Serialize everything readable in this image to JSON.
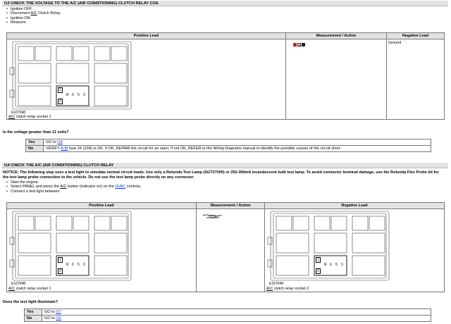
{
  "section1": {
    "heading": "I13   CHECK THE VOLTAGE TO THE A/C (AIR CONDITIONING) CLUTCH RELAY COIL",
    "steps": [
      {
        "pre": "Ignition OFF.",
        "u": "",
        "post": ""
      },
      {
        "pre": "Disconnect ",
        "u": "A/C",
        "post": " Clutch Relay."
      },
      {
        "pre": "Ignition ON.",
        "u": "",
        "post": ""
      },
      {
        "pre": "Measure:",
        "u": "",
        "post": ""
      }
    ],
    "table": {
      "headers": [
        "Positive Lead",
        "Measurement / Action",
        "Negative Lead"
      ],
      "figure_code": "E167048",
      "pins": {
        "p1": "1",
        "p2": "2",
        "r": "R",
        "p6": "6",
        "p5": "5",
        "p3": "3"
      },
      "caption_u": "A/C",
      "caption_rest": " clutch relay socket 1",
      "meter_icons": [
        "meter-red-icon",
        "meter-volt-icon",
        "meter-dc-icon"
      ],
      "negative": "Ground"
    },
    "question": "Is the voltage greater than 11 volts?",
    "answers": [
      {
        "key": "Yes",
        "pre": "GO to ",
        "link": "I14",
        "rest": ""
      },
      {
        "key": "No",
        "pre": "VERIFY ",
        "link": "BJB",
        "rest": " fuse 24 (10A) is OK. If OK, REPAIR the circuit for an open. If not OK, REFER to the Wiring Diagrams manual to identify the possible causes of the circuit short."
      }
    ]
  },
  "section2": {
    "heading": "I14   CHECK THE A/C (AIR CONDITIONING) CLUTCH RELAY",
    "notice": "NOTICE: The following step uses a test light to simulate normal circuit loads. Use only a Rotunda Test Lamp (SGT27000) or 250-300mA incandescent bulb test lamp. To avoid connector terminal damage, use the Rotunda Flex Probe kit for the test lamp probe connection to the vehicle. Do not use the test lamp probe directly on any connector.",
    "steps": [
      {
        "pre": "Start the engine.",
        "u": "",
        "post": ""
      },
      {
        "pre": "Select PANEL and press the ",
        "u": "A/C",
        "post": " button (indicator on) on the "
      },
      {
        "pre": "Connect a test light between:",
        "u": "",
        "post": ""
      }
    ],
    "hvac_link": "HVAC",
    "hvac_tail": " controls.",
    "table": {
      "headers": [
        "Positive Lead",
        "Measurement / Action",
        "Negative Lead"
      ],
      "left_figure_code": "E167048",
      "right_figure_code": "E167048",
      "left_caption_rest": " clutch relay socket 1",
      "right_caption_rest": " clutch relay socket 2",
      "caption_u": "A/C",
      "pins": {
        "p1": "1",
        "p2": "2",
        "r": "R",
        "p6": "6",
        "p5": "5",
        "p3": "3"
      }
    },
    "question": "Does the test light illuminate?",
    "answers": [
      {
        "key": "Yes",
        "pre": "GO to ",
        "link": "I17"
      },
      {
        "key": "No",
        "pre": "GO to ",
        "link": "I15"
      }
    ]
  }
}
